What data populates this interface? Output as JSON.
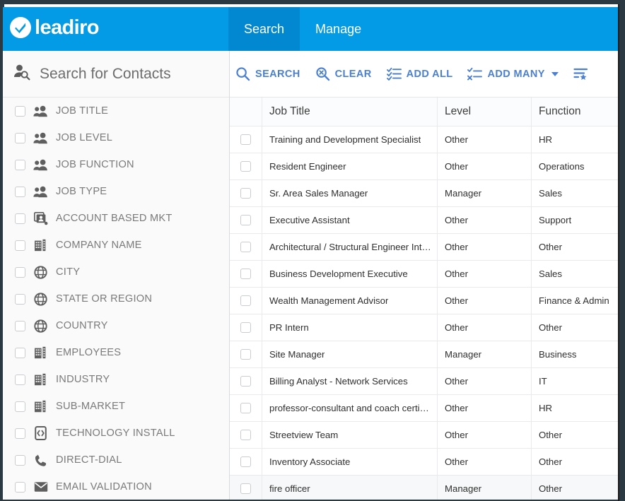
{
  "brand": {
    "name": "leadiro",
    "logo_icon": "check-circle-icon",
    "bar_color": "#039BE5"
  },
  "nav": {
    "tabs": [
      {
        "label": "Search",
        "active": true
      },
      {
        "label": "Manage",
        "active": false
      }
    ]
  },
  "sidebar": {
    "title": "Search for Contacts",
    "title_icon": "person-search-icon",
    "items": [
      {
        "label": "JOB TITLE",
        "icon": "people-icon"
      },
      {
        "label": "JOB LEVEL",
        "icon": "people-icon"
      },
      {
        "label": "JOB FUNCTION",
        "icon": "people-icon"
      },
      {
        "label": "JOB TYPE",
        "icon": "people-icon"
      },
      {
        "label": "ACCOUNT BASED MKT",
        "icon": "account-card-icon"
      },
      {
        "label": "COMPANY NAME",
        "icon": "building-icon"
      },
      {
        "label": "CITY",
        "icon": "globe-icon"
      },
      {
        "label": "STATE OR REGION",
        "icon": "globe-icon"
      },
      {
        "label": "COUNTRY",
        "icon": "globe-icon"
      },
      {
        "label": "EMPLOYEES",
        "icon": "building-icon"
      },
      {
        "label": "INDUSTRY",
        "icon": "building-icon"
      },
      {
        "label": "SUB-MARKET",
        "icon": "building-icon"
      },
      {
        "label": "TECHNOLOGY INSTALL",
        "icon": "device-code-icon"
      },
      {
        "label": "DIRECT-DIAL",
        "icon": "phone-icon"
      },
      {
        "label": "EMAIL VALIDATION",
        "icon": "envelope-icon"
      }
    ]
  },
  "toolbar": {
    "accent_color": "#4a7fd4",
    "buttons": [
      {
        "label": "SEARCH",
        "icon": "search-icon",
        "caret": false
      },
      {
        "label": "CLEAR",
        "icon": "search-clear-icon",
        "caret": false
      },
      {
        "label": "ADD ALL",
        "icon": "checklist-icon",
        "caret": false
      },
      {
        "label": "ADD MANY",
        "icon": "check-x-list-icon",
        "caret": true
      }
    ],
    "saved_search_icon": "list-star-icon"
  },
  "table": {
    "columns": [
      "Job Title",
      "Level",
      "Function"
    ],
    "rows": [
      {
        "title": "Training and Development Specialist",
        "level": "Other",
        "function": "HR"
      },
      {
        "title": "Resident Engineer",
        "level": "Other",
        "function": "Operations"
      },
      {
        "title": "Sr. Area Sales Manager",
        "level": "Manager",
        "function": "Sales"
      },
      {
        "title": "Executive Assistant",
        "level": "Other",
        "function": "Support"
      },
      {
        "title": "Architectural / Structural Engineer Int…",
        "level": "Other",
        "function": "Other"
      },
      {
        "title": "Business Development Executive",
        "level": "Other",
        "function": "Sales"
      },
      {
        "title": "Wealth Management Advisor",
        "level": "Other",
        "function": "Finance & Admin"
      },
      {
        "title": "PR Intern",
        "level": "Other",
        "function": "Other"
      },
      {
        "title": "Site Manager",
        "level": "Manager",
        "function": "Business"
      },
      {
        "title": "Billing Analyst - Network Services",
        "level": "Other",
        "function": "IT"
      },
      {
        "title": "professor-consultant and coach certi…",
        "level": "Other",
        "function": "HR"
      },
      {
        "title": "Streetview Team",
        "level": "Other",
        "function": "Other"
      },
      {
        "title": "Inventory Associate",
        "level": "Other",
        "function": "Other"
      },
      {
        "title": "fire officer",
        "level": "Manager",
        "function": "Other",
        "shaded": true
      }
    ]
  }
}
